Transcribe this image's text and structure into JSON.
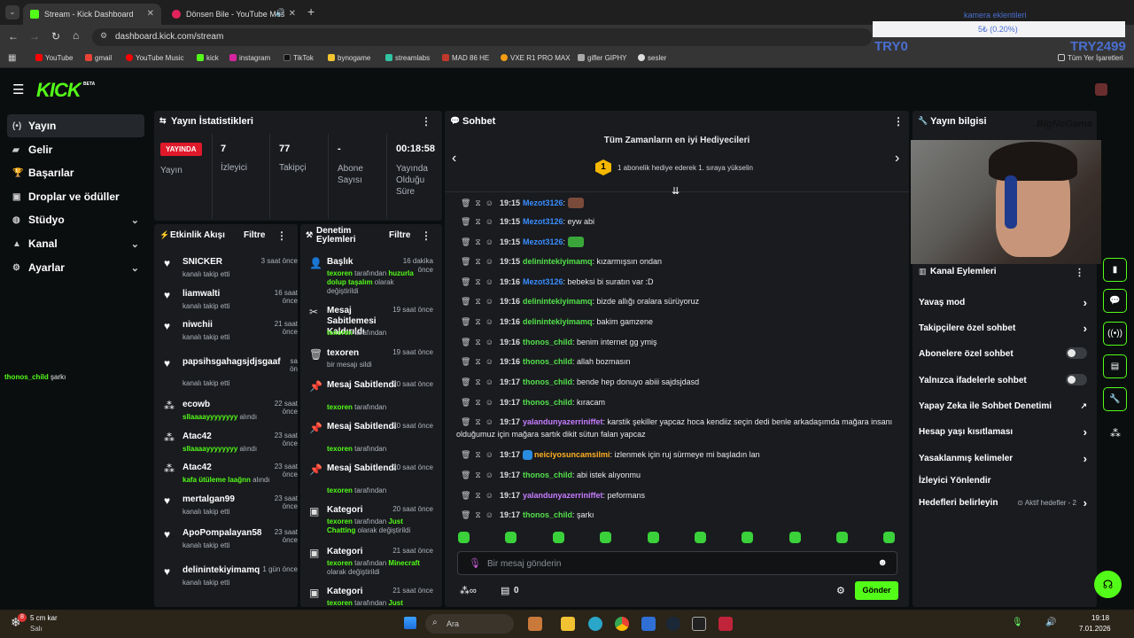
{
  "browser": {
    "tabs": [
      {
        "title": "Stream - Kick Dashboard"
      },
      {
        "title": "Dönsen Bile - YouTube Mus"
      }
    ],
    "url": "dashboard.kick.com/stream",
    "bookmarks": [
      "YouTube",
      "gmail",
      "YouTube Music",
      "kick",
      "instagram",
      "TikTok",
      "bynogame",
      "streamlabs",
      "MAD 86 HE",
      "VXE R1 PRO MAX",
      "gifler GIPHY",
      "sesler"
    ],
    "all_bookmarks": "Tüm Yer İşaretleri"
  },
  "overlay": {
    "label": "kamera eklentileri",
    "value": "5₺ (0.20%)",
    "left_name": "TRY0",
    "right_name": "TRY2499",
    "floating_user": "thonos_child",
    "floating_text": "şarkı",
    "brand": "BigNoGame"
  },
  "kick": {
    "logo": "KICK",
    "beta": "BETA"
  },
  "nav": [
    {
      "label": "Yayın",
      "icon": "(•)"
    },
    {
      "label": "Gelir",
      "icon": "▰"
    },
    {
      "label": "Başarılar",
      "icon": "🏆"
    },
    {
      "label": "Droplar ve ödüller",
      "icon": "▣"
    },
    {
      "label": "Stüdyo",
      "icon": "◍"
    },
    {
      "label": "Kanal",
      "icon": "▲"
    },
    {
      "label": "Ayarlar",
      "icon": "⚙"
    }
  ],
  "stats": {
    "title": "Yayın İstatistikleri",
    "live_badge": "YAYINDA",
    "items": [
      {
        "value": "",
        "label": "Yayın"
      },
      {
        "value": "7",
        "label": "İzleyici"
      },
      {
        "value": "77",
        "label": "Takipçi"
      },
      {
        "value": "-",
        "label": "Abone Sayısı"
      },
      {
        "value": "00:18:58",
        "label": "Yayında Olduğu Süre"
      }
    ]
  },
  "activity": {
    "title": "Etkinlik Akışı",
    "filter": "Filtre",
    "events": [
      {
        "name": "SNICKER",
        "time": "3 saat önce",
        "desc": "kanalı takip etti",
        "icon": "heart"
      },
      {
        "name": "liamwalti",
        "time": "16 saat önce",
        "desc": "kanalı takip etti",
        "icon": "heart"
      },
      {
        "name": "niwchii",
        "time": "21 saat önce",
        "desc": "kanalı takip etti",
        "icon": "heart"
      },
      {
        "name": "papsihsgahagsjdjsgaaf",
        "time": "sa ön",
        "desc": "kanalı takip etti",
        "icon": "heart"
      },
      {
        "name": "ecowb",
        "time": "22 saat önce",
        "desc_green": "sllaaaayyyyyyyy",
        "desc": "alındı",
        "icon": "dots"
      },
      {
        "name": "Atac42",
        "time": "23 saat önce",
        "desc_green": "sllaaaayyyyyyyy",
        "desc": "alındı",
        "icon": "dots"
      },
      {
        "name": "Atac42",
        "time": "23 saat önce",
        "desc_green": "kafa ütüleme laağnn",
        "desc": "alındı",
        "icon": "dots"
      },
      {
        "name": "mertalgan99",
        "time": "23 saat önce",
        "desc": "kanalı takip etti",
        "icon": "heart"
      },
      {
        "name": "ApoPompalayan58",
        "time": "23 saat önce",
        "desc": "kanalı takip etti",
        "icon": "heart"
      },
      {
        "name": "delinintekiyimamq",
        "time": "1 gün önce",
        "desc": "kanalı takip etti",
        "icon": "heart"
      }
    ]
  },
  "moderation": {
    "title": "Denetim Eylemleri",
    "filter": "Filtre",
    "items": [
      {
        "name": "Başlık",
        "time": "16 dakika önce",
        "actor": "texoren",
        "pre": "tarafından",
        "green": "huzurla dolup taşalım",
        "post": "olarak değiştirildi",
        "icon": "person"
      },
      {
        "name": "Mesaj Sabitlemesi Kaldırıldı",
        "time": "19 saat önce",
        "actor": "texoren",
        "pre": "tarafından",
        "green": "",
        "post": "",
        "icon": "unpin"
      },
      {
        "name": "texoren",
        "time": "19 saat önce",
        "actor": "",
        "pre": "bir mesajı sildi",
        "green": "",
        "post": "",
        "icon": "trash"
      },
      {
        "name": "Mesaj Sabitlendi",
        "time": "20 saat önce",
        "actor": "texoren",
        "pre": "tarafından",
        "green": "",
        "post": "",
        "icon": "pin"
      },
      {
        "name": "Mesaj Sabitlendi",
        "time": "20 saat önce",
        "actor": "texoren",
        "pre": "tarafından",
        "green": "",
        "post": "",
        "icon": "pin"
      },
      {
        "name": "Mesaj Sabitlendi",
        "time": "20 saat önce",
        "actor": "texoren",
        "pre": "tarafından",
        "green": "",
        "post": "",
        "icon": "pin"
      },
      {
        "name": "Kategori",
        "time": "20 saat önce",
        "actor": "texoren",
        "pre": "tarafından",
        "green": "Just Chatting",
        "post": "olarak değiştirildi",
        "icon": "category"
      },
      {
        "name": "Kategori",
        "time": "21 saat önce",
        "actor": "texoren",
        "pre": "tarafından",
        "green": "Minecraft",
        "post": "olarak değiştirildi",
        "icon": "category"
      },
      {
        "name": "Kategori",
        "time": "21 saat önce",
        "actor": "texoren",
        "pre": "tarafından",
        "green": "Just",
        "post": "",
        "icon": "category"
      }
    ]
  },
  "chat": {
    "title": "Sohbet",
    "leaderboard_title": "Tüm Zamanların en iyi Hediyecileri",
    "leaderboard_rank": "1",
    "leaderboard_text": "1 abonelik hediye ederek 1. sıraya yükselin",
    "messages": [
      {
        "time": "19:15",
        "user": "Mezot3126",
        "color": "#3a8dff",
        "text": "",
        "emote": true
      },
      {
        "time": "19:15",
        "user": "Mezot3126",
        "color": "#3a8dff",
        "text": "eyw abi"
      },
      {
        "time": "19:15",
        "user": "Mezot3126",
        "color": "#3a8dff",
        "text": "",
        "emote": true
      },
      {
        "time": "19:15",
        "user": "delinintekiyimamq",
        "color": "#53e04a",
        "text": "kızarmışsın ondan"
      },
      {
        "time": "19:16",
        "user": "Mezot3126",
        "color": "#3a8dff",
        "text": "bebeksi bi suratın var :D"
      },
      {
        "time": "19:16",
        "user": "delinintekiyimamq",
        "color": "#53e04a",
        "text": "bizde allığı oralara sürüyoruz"
      },
      {
        "time": "19:16",
        "user": "delinintekiyimamq",
        "color": "#53e04a",
        "text": "bakim gamzene"
      },
      {
        "time": "19:16",
        "user": "thonos_child",
        "color": "#53e04a",
        "text": "benim internet gg ymiş"
      },
      {
        "time": "19:16",
        "user": "thonos_child",
        "color": "#53e04a",
        "text": "allah bozmasın"
      },
      {
        "time": "19:17",
        "user": "thonos_child",
        "color": "#53e04a",
        "text": "bende hep donuyo abiii sajdsjdasd"
      },
      {
        "time": "19:17",
        "user": "thonos_child",
        "color": "#53e04a",
        "text": "kıracam"
      },
      {
        "time": "19:17",
        "user": "yalandunyazerriniffet",
        "color": "#c77dff",
        "text": "karstik şekiller yapcaz hoca kendiiz seçin dedi benle arkadaşımda mağara insanı",
        "text2": "olduğumuz için mağara sartık dikit sütun falan yapcaz"
      },
      {
        "time": "19:17",
        "user": "neiciyosuncamsilmi",
        "color": "#ffb020",
        "text": "izlenmek için ruj sürmeye mi başladın lan"
      },
      {
        "time": "19:17",
        "user": "thonos_child",
        "color": "#53e04a",
        "text": "abi istek alıyonmu"
      },
      {
        "time": "19:17",
        "user": "yalandunyazerriniffet",
        "color": "#c77dff",
        "text": "peformans"
      },
      {
        "time": "19:17",
        "user": "thonos_child",
        "color": "#53e04a",
        "text": "şarkı"
      }
    ],
    "input_placeholder": "Bir mesaj gönderin",
    "points": "0",
    "send": "Gönder"
  },
  "right": {
    "title": "Yayın bilgisi",
    "actions_title": "Kanal Eylemleri",
    "actions": [
      {
        "label": "Yavaş mod",
        "type": "arrow"
      },
      {
        "label": "Takipçilere özel sohbet",
        "type": "arrow"
      },
      {
        "label": "Abonelere özel sohbet",
        "type": "toggle"
      },
      {
        "label": "Yalnızca ifadelerle sohbet",
        "type": "toggle"
      },
      {
        "label": "Yapay Zeka ile Sohbet Denetimi",
        "type": "link"
      },
      {
        "label": "Hesap yaşı kısıtlaması",
        "type": "arrow"
      },
      {
        "label": "Yasaklanmış kelimeler",
        "type": "arrow"
      },
      {
        "label": "İzleyici Yönlendir",
        "type": "none"
      },
      {
        "label": "Hedefleri belirleyin",
        "type": "goal",
        "extra": "Aktif hedefler - 2"
      }
    ]
  },
  "taskbar": {
    "weather_temp": "5 cm kar",
    "weather_day": "Salı",
    "weather_badge": "8",
    "search": "Ara",
    "time": "19:18",
    "date": "7.01.2026"
  }
}
